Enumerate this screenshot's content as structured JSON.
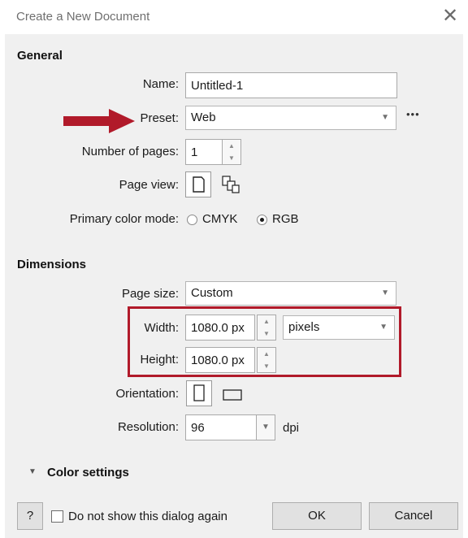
{
  "dialog": {
    "title": "Create a New Document",
    "close_label": "✕"
  },
  "general": {
    "section_label": "General",
    "name_label": "Name:",
    "name_value": "Untitled-1",
    "preset_label": "Preset:",
    "preset_value": "Web",
    "more_label": "•••",
    "pages_label": "Number of pages:",
    "pages_value": "1",
    "page_view_label": "Page view:",
    "color_mode_label": "Primary color mode:",
    "color_modes": [
      "CMYK",
      "RGB"
    ],
    "color_mode_selected": "RGB"
  },
  "dimensions": {
    "section_label": "Dimensions",
    "page_size_label": "Page size:",
    "page_size_value": "Custom",
    "width_label": "Width:",
    "width_value": "1080.0 px",
    "units_value": "pixels",
    "height_label": "Height:",
    "height_value": "1080.0 px",
    "orientation_label": "Orientation:",
    "resolution_label": "Resolution:",
    "resolution_value": "96",
    "resolution_unit": "dpi"
  },
  "color_settings": {
    "label": "Color settings"
  },
  "footer": {
    "help_label": "?",
    "dont_show_label": "Do not show this dialog again",
    "ok_label": "OK",
    "cancel_label": "Cancel"
  },
  "annotations": {
    "arrow_color": "#b11a2a",
    "box_color": "#b11a2a"
  }
}
